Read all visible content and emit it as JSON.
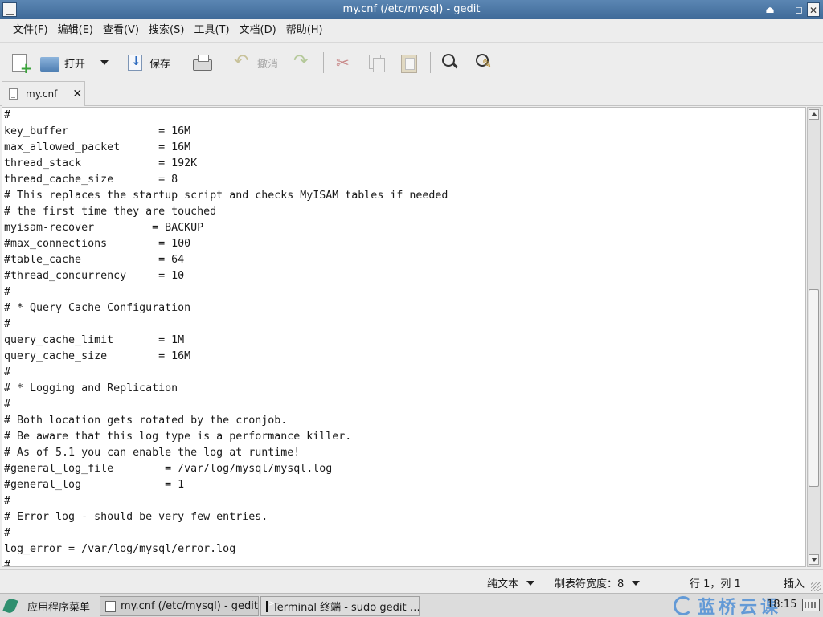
{
  "window": {
    "title": "my.cnf (/etc/mysql) - gedit",
    "controls": [
      "⏏",
      "–",
      "◻",
      "✕"
    ]
  },
  "menu": [
    "文件(F)",
    "编辑(E)",
    "查看(V)",
    "搜索(S)",
    "工具(T)",
    "文档(D)",
    "帮助(H)"
  ],
  "toolbar": {
    "open_label": "打开",
    "save_label": "保存",
    "undo_label": "撤消"
  },
  "tab": {
    "label": "my.cnf",
    "close": "✕"
  },
  "editor_lines": [
    "#",
    "key_buffer              = 16M",
    "max_allowed_packet      = 16M",
    "thread_stack            = 192K",
    "thread_cache_size       = 8",
    "# This replaces the startup script and checks MyISAM tables if needed",
    "# the first time they are touched",
    "myisam-recover         = BACKUP",
    "#max_connections        = 100",
    "#table_cache            = 64",
    "#thread_concurrency     = 10",
    "#",
    "# * Query Cache Configuration",
    "#",
    "query_cache_limit       = 1M",
    "query_cache_size        = 16M",
    "#",
    "# * Logging and Replication",
    "#",
    "# Both location gets rotated by the cronjob.",
    "# Be aware that this log type is a performance killer.",
    "# As of 5.1 you can enable the log at runtime!",
    "#general_log_file        = /var/log/mysql/mysql.log",
    "#general_log             = 1",
    "#",
    "# Error log - should be very few entries.",
    "#",
    "log_error = /var/log/mysql/error.log",
    "#"
  ],
  "statusbar": {
    "language": "纯文本",
    "tab_width": "制表符宽度：8",
    "cursor": "行 1，列 1",
    "mode": "插入"
  },
  "taskbar": {
    "start_label": "应用程序菜单",
    "tasks": [
      "my.cnf (/etc/mysql) - gedit",
      "Terminal 终端 - sudo gedit …"
    ],
    "brand": "蓝桥云课",
    "clock": "18:15"
  }
}
